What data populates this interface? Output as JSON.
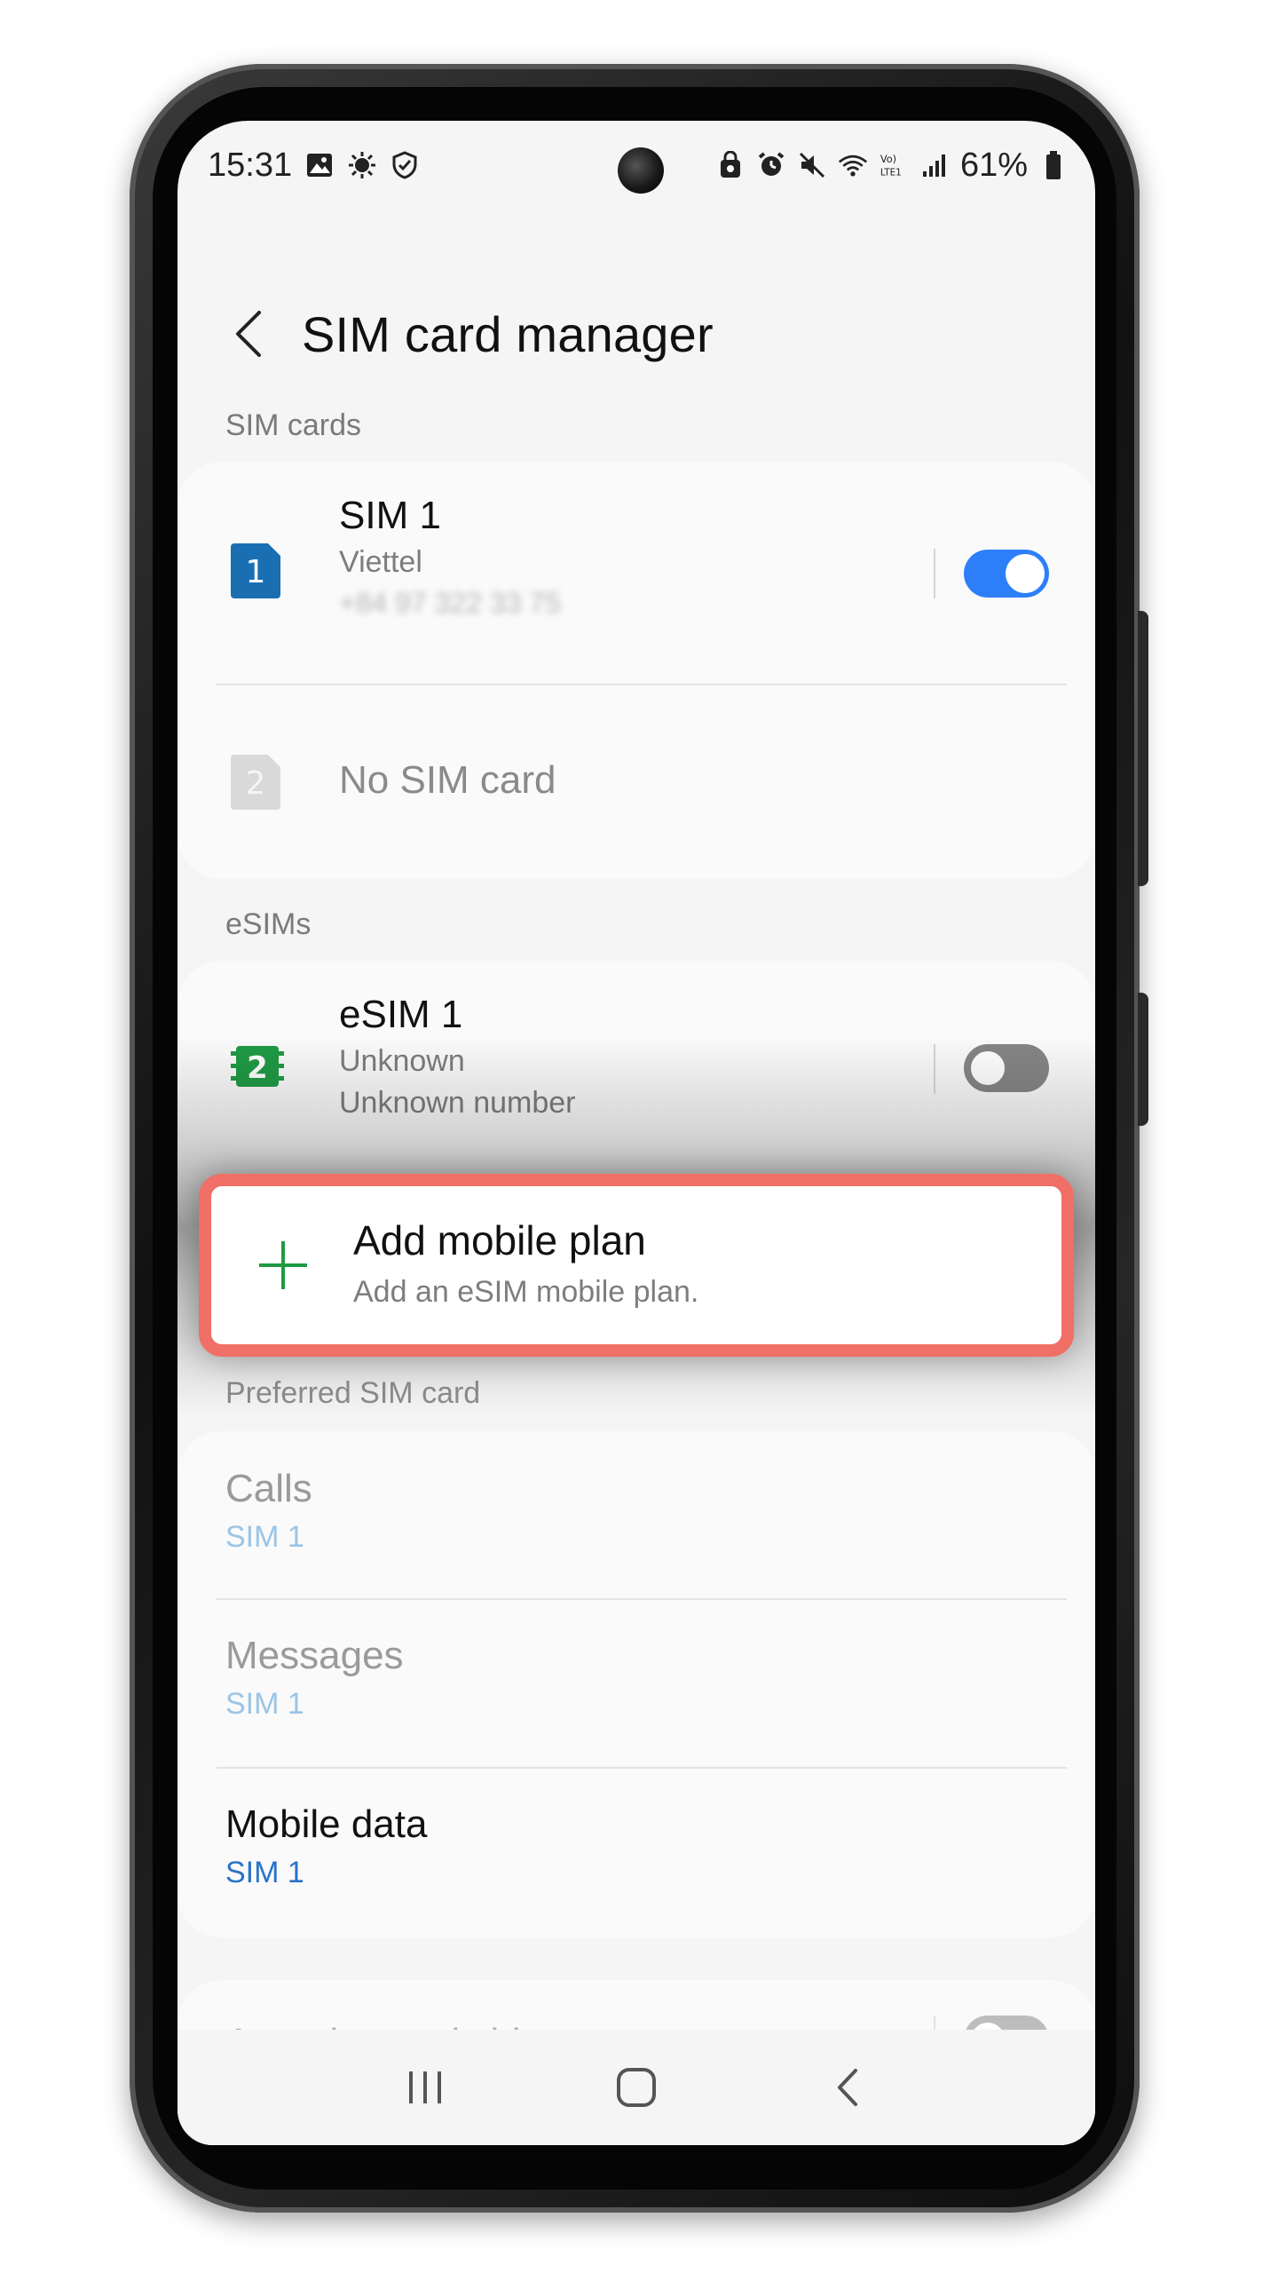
{
  "status_bar": {
    "time": "15:31",
    "battery": "61%"
  },
  "header": {
    "title": "SIM card manager"
  },
  "sections": {
    "sim_cards": "SIM cards",
    "esims": "eSIMs",
    "preferred": "Preferred SIM card"
  },
  "sim_cards": [
    {
      "badge": "1",
      "name": "SIM 1",
      "carrier": "Viettel",
      "number": "+84 97 322 33 75",
      "enabled": true
    },
    {
      "badge": "2",
      "name": "No SIM card"
    }
  ],
  "esim": {
    "badge": "2",
    "name": "eSIM 1",
    "carrier": "Unknown",
    "number": "Unknown number",
    "enabled": false
  },
  "add_plan": {
    "title": "Add mobile plan",
    "subtitle": "Add an eSIM mobile plan."
  },
  "preferred": [
    {
      "label": "Calls",
      "value": "SIM 1",
      "enabled": false
    },
    {
      "label": "Messages",
      "value": "SIM 1",
      "enabled": false
    },
    {
      "label": "Mobile data",
      "value": "SIM 1",
      "enabled": true
    }
  ],
  "auto_data": {
    "label": "Auto data switching",
    "enabled": false
  },
  "colors": {
    "accent": "#2d7ff9",
    "highlight": "#f06f66",
    "sim1_badge": "#1a6fb3",
    "esim_badge": "#1f9a44"
  }
}
